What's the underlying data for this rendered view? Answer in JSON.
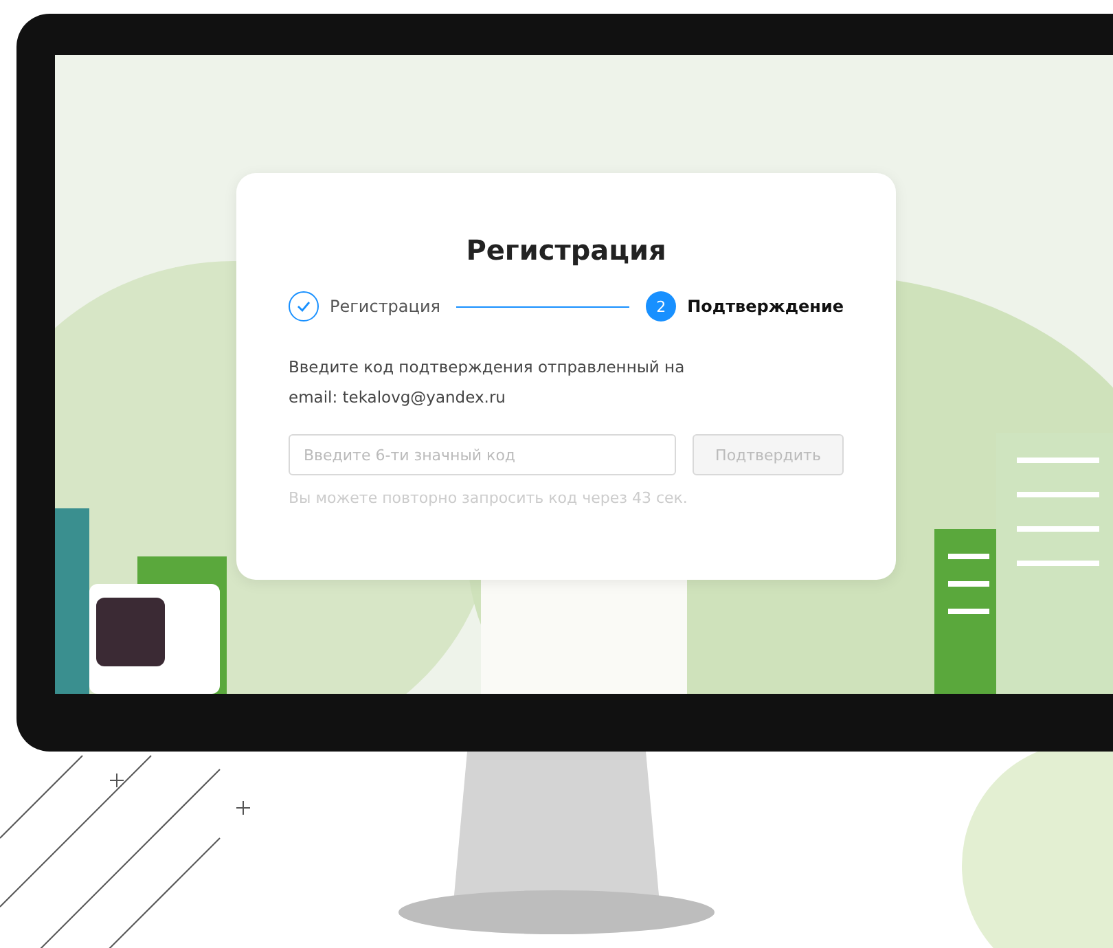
{
  "screen": {
    "title": "Регистрация",
    "steps": [
      {
        "label": "Регистрация",
        "done": true,
        "selected": false
      },
      {
        "number": "2",
        "label": "Подтверждение",
        "done": false,
        "selected": true
      }
    ],
    "message": "Введите код подтверждения отправленный на email: tekalovg@yandex.ru",
    "code_field": {
      "placeholder": "Введите 6-ти значный код"
    },
    "submit_button": {
      "label": "Подтвердить",
      "disabled": true
    },
    "resend_note": "Вы можете повторно запросить код через 43 сек."
  }
}
